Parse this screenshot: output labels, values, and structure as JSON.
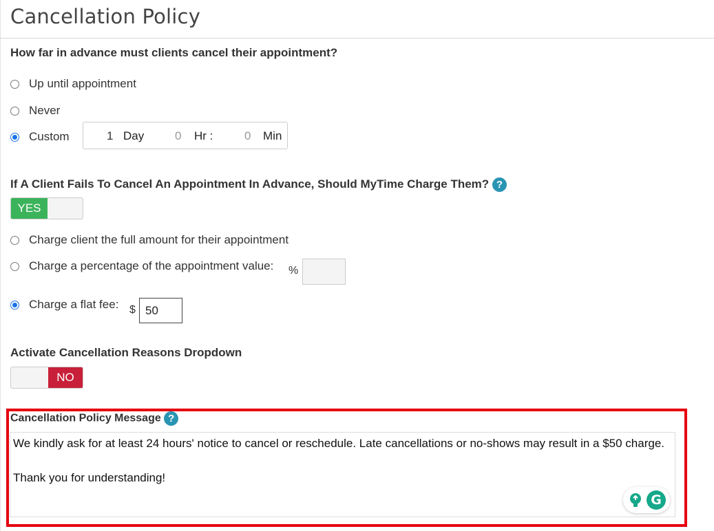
{
  "page": {
    "title": "Cancellation Policy"
  },
  "advance": {
    "question": "How far in advance must clients cancel their appointment?",
    "options": [
      {
        "label": "Up until appointment",
        "checked": false
      },
      {
        "label": "Never",
        "checked": false
      },
      {
        "label": "Custom",
        "checked": true
      }
    ],
    "custom": {
      "days_value": "1",
      "days_unit": "Day",
      "hours_value": "0",
      "hours_unit": "Hr :",
      "minutes_value": "0",
      "minutes_unit": "Min"
    }
  },
  "charge": {
    "question": "If A Client Fails To Cancel An Appointment In Advance, Should MyTime Charge Them?",
    "help_icon": "?",
    "toggle_label": "YES",
    "toggle_state": "on",
    "options": [
      {
        "label": "Charge client the full amount for their appointment",
        "checked": false
      },
      {
        "label": "Charge a percentage of the appointment value:",
        "checked": false
      },
      {
        "label": "Charge a flat fee:",
        "checked": true
      }
    ],
    "percent_symbol": "%",
    "percent_value": "",
    "currency_symbol": "$",
    "flat_fee_value": "50"
  },
  "reasons": {
    "heading": "Activate Cancellation Reasons Dropdown",
    "toggle_label": "NO",
    "toggle_state": "off"
  },
  "message": {
    "heading": "Cancellation Policy Message",
    "help_icon": "?",
    "line1": "We kindly ask for at least 24 hours' notice to cancel or reschedule. Late cancellations or no-shows may result in a $50 charge.",
    "line2": "Thank you for understanding!"
  },
  "colors": {
    "toggle_on": "#3bb35a",
    "toggle_off": "#c8203a",
    "radio_checked": "#1a73e8",
    "help_icon": "#2a94b3",
    "highlight": "#e5000f",
    "grammarly": "#15a88a"
  },
  "icons": [
    "help-icon",
    "grammarly-bulb-icon",
    "grammarly-logo-icon"
  ]
}
